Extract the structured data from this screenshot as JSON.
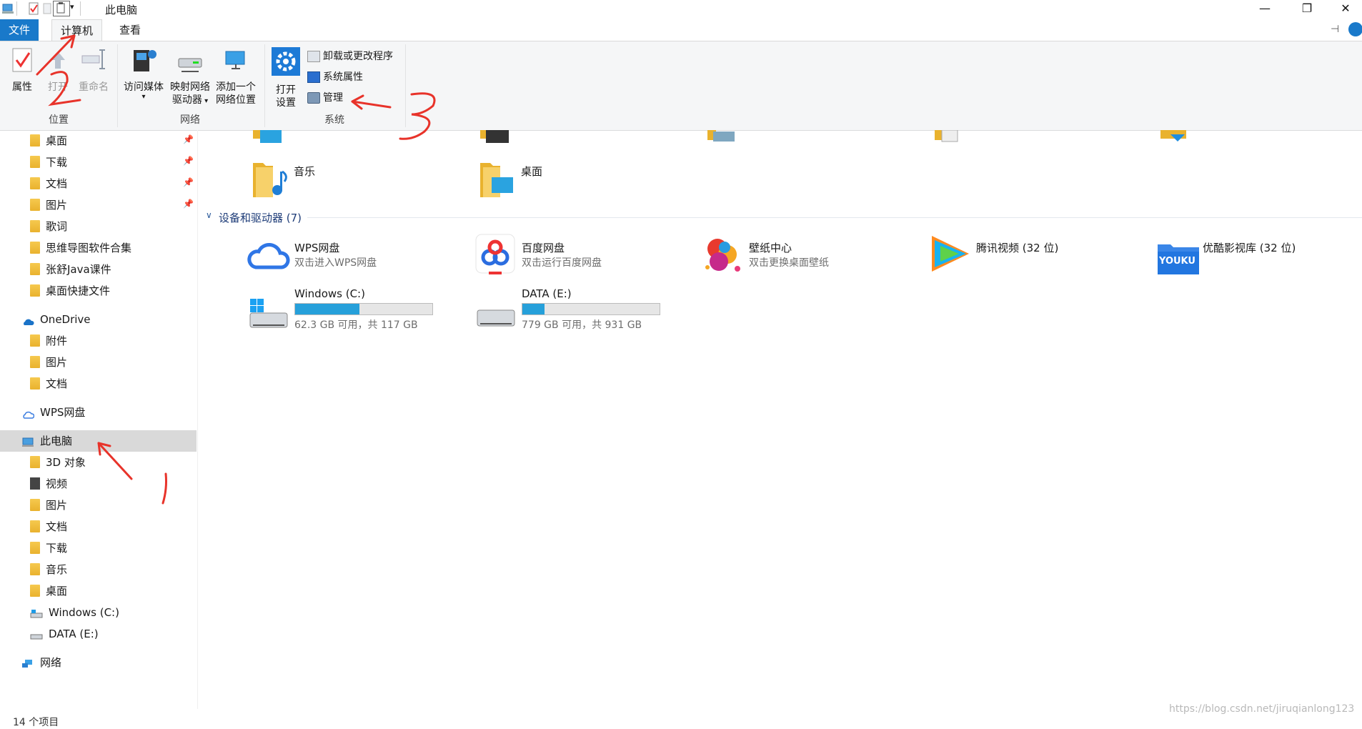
{
  "window": {
    "title": "此电脑"
  },
  "tabs": {
    "file": "文件",
    "computer": "计算机",
    "view": "查看"
  },
  "ribbon": {
    "location": {
      "label": "位置",
      "properties": "属性",
      "open": "打开",
      "rename": "重命名"
    },
    "network": {
      "label": "网络",
      "access_media": "访问媒体",
      "map_drive_1": "映射网络",
      "map_drive_2": "驱动器",
      "add_location_1": "添加一个",
      "add_location_2": "网络位置"
    },
    "system": {
      "label": "系统",
      "open_settings_1": "打开",
      "open_settings_2": "设置",
      "uninstall": "卸载或更改程序",
      "sys_props": "系统属性",
      "manage": "管理"
    }
  },
  "nav": {
    "quick": [
      "桌面",
      "下载",
      "文档",
      "图片",
      "歌词",
      "思维导图软件合集",
      "张舒Java课件",
      "桌面快捷文件"
    ],
    "onedrive": {
      "label": "OneDrive",
      "items": [
        "附件",
        "图片",
        "文档"
      ]
    },
    "wps": "WPS网盘",
    "thispc": {
      "label": "此电脑",
      "items": [
        "3D 对象",
        "视频",
        "图片",
        "文档",
        "下载",
        "音乐",
        "桌面",
        "Windows (C:)",
        "DATA (E:)"
      ]
    },
    "network": "网络"
  },
  "folders": {
    "music": "音乐",
    "desktop": "桌面"
  },
  "devices": {
    "header": "设备和驱动器 (7)",
    "wps": {
      "name": "WPS网盘",
      "desc": "双击进入WPS网盘"
    },
    "baidu": {
      "name": "百度网盘",
      "desc": "双击运行百度网盘"
    },
    "wallpaper": {
      "name": "壁纸中心",
      "desc": "双击更换桌面壁纸"
    },
    "tencent": {
      "name": "腾讯视频 (32 位)"
    },
    "youku": {
      "name": "优酷影视库 (32 位)",
      "logo": "YOUKU"
    },
    "drive_c": {
      "name": "Windows (C:)",
      "desc": "62.3 GB 可用，共 117 GB",
      "used_fraction": 0.47
    },
    "drive_e": {
      "name": "DATA (E:)",
      "desc": "779 GB 可用，共 931 GB",
      "used_fraction": 0.16
    }
  },
  "status": {
    "items": "14 个项目"
  },
  "watermark": "https://blog.csdn.net/jiruqianlong123",
  "annotations": {
    "n1": "1",
    "n2": "2",
    "n3": "3"
  },
  "colors": {
    "accent": "#1979ca",
    "selected": "#d9d9d9",
    "drive_fill": "#26a0da",
    "annotation": "#e8332a"
  }
}
